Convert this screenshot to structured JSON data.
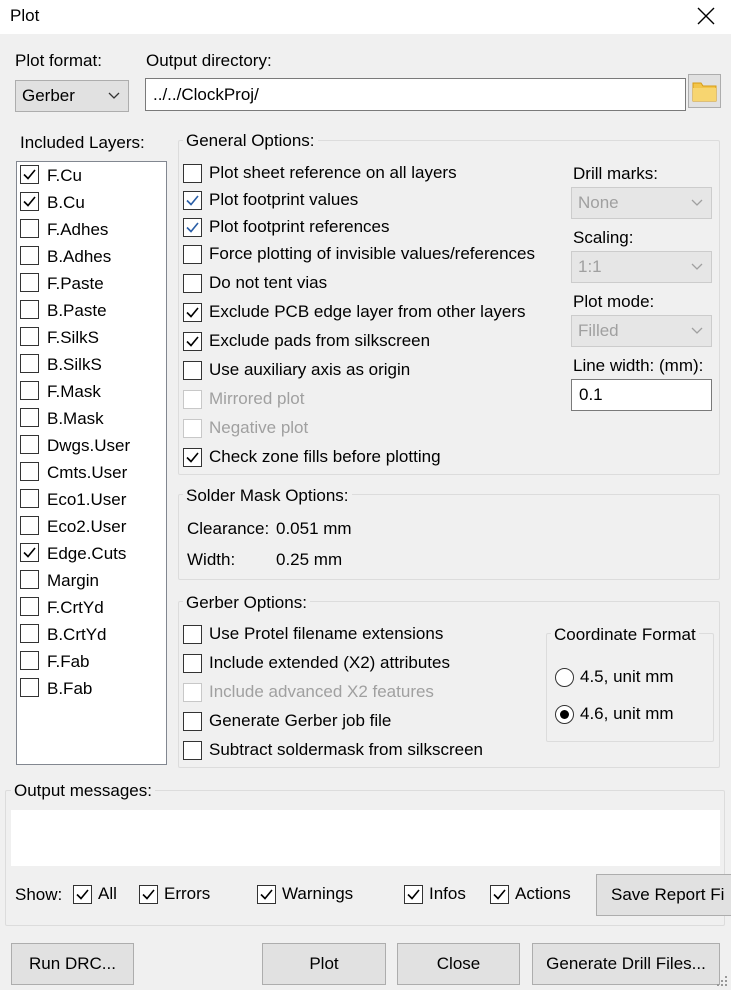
{
  "window": {
    "title": "Plot"
  },
  "plot_format": {
    "label": "Plot format:",
    "value": "Gerber"
  },
  "output_directory": {
    "label": "Output directory:",
    "value": "../../ClockProj/"
  },
  "layers": {
    "title": "Included Layers:",
    "items": [
      {
        "label": "F.Cu",
        "checked": true
      },
      {
        "label": "B.Cu",
        "checked": true
      },
      {
        "label": "F.Adhes",
        "checked": false
      },
      {
        "label": "B.Adhes",
        "checked": false
      },
      {
        "label": "F.Paste",
        "checked": false
      },
      {
        "label": "B.Paste",
        "checked": false
      },
      {
        "label": "F.SilkS",
        "checked": false
      },
      {
        "label": "B.SilkS",
        "checked": false
      },
      {
        "label": "F.Mask",
        "checked": false
      },
      {
        "label": "B.Mask",
        "checked": false
      },
      {
        "label": "Dwgs.User",
        "checked": false
      },
      {
        "label": "Cmts.User",
        "checked": false
      },
      {
        "label": "Eco1.User",
        "checked": false
      },
      {
        "label": "Eco2.User",
        "checked": false
      },
      {
        "label": "Edge.Cuts",
        "checked": true
      },
      {
        "label": "Margin",
        "checked": false
      },
      {
        "label": "F.CrtYd",
        "checked": false
      },
      {
        "label": "B.CrtYd",
        "checked": false
      },
      {
        "label": "F.Fab",
        "checked": false
      },
      {
        "label": "B.Fab",
        "checked": false
      }
    ]
  },
  "general": {
    "title": "General Options:",
    "options": [
      {
        "label": "Plot sheet reference on all layers",
        "checked": false,
        "enabled": true
      },
      {
        "label": "Plot footprint values",
        "checked": true,
        "enabled": true
      },
      {
        "label": "Plot footprint references",
        "checked": true,
        "enabled": true
      },
      {
        "label": "Force plotting of invisible values/references",
        "checked": false,
        "enabled": true
      },
      {
        "label": "Do not tent vias",
        "checked": false,
        "enabled": true
      },
      {
        "label": "Exclude PCB edge layer from other layers",
        "checked": true,
        "enabled": true
      },
      {
        "label": "Exclude pads from silkscreen",
        "checked": true,
        "enabled": true
      },
      {
        "label": "Use auxiliary axis as origin",
        "checked": false,
        "enabled": true
      },
      {
        "label": "Mirrored plot",
        "checked": false,
        "enabled": false
      },
      {
        "label": "Negative plot",
        "checked": false,
        "enabled": false
      },
      {
        "label": "Check zone fills before plotting",
        "checked": true,
        "enabled": true
      }
    ],
    "drill_marks": {
      "label": "Drill marks:",
      "value": "None"
    },
    "scaling": {
      "label": "Scaling:",
      "value": "1:1"
    },
    "plot_mode": {
      "label": "Plot mode:",
      "value": "Filled"
    },
    "line_width": {
      "label": "Line width: (mm):",
      "value": "0.1"
    }
  },
  "solder_mask": {
    "title": "Solder Mask Options:",
    "clearance_label": "Clearance:",
    "clearance_value": "0.051 mm",
    "width_label": "Width:",
    "width_value": "0.25 mm"
  },
  "gerber": {
    "title": "Gerber Options:",
    "options": [
      {
        "label": "Use Protel filename extensions",
        "checked": false,
        "enabled": true
      },
      {
        "label": "Include extended (X2) attributes",
        "checked": false,
        "enabled": true
      },
      {
        "label": "Include advanced X2 features",
        "checked": false,
        "enabled": false
      },
      {
        "label": "Generate Gerber job file",
        "checked": false,
        "enabled": true
      },
      {
        "label": "Subtract soldermask from silkscreen",
        "checked": false,
        "enabled": true
      }
    ],
    "coordinate_format": {
      "title": "Coordinate Format",
      "options": [
        {
          "label": "4.5, unit mm",
          "selected": false
        },
        {
          "label": "4.6, unit mm",
          "selected": true
        }
      ]
    }
  },
  "messages": {
    "title": "Output messages:",
    "show_label": "Show:",
    "filters": [
      {
        "label": "All",
        "checked": true
      },
      {
        "label": "Errors",
        "checked": true
      },
      {
        "label": "Warnings",
        "checked": true
      },
      {
        "label": "Infos",
        "checked": true
      },
      {
        "label": "Actions",
        "checked": true
      }
    ],
    "save_report": "Save Report Fi"
  },
  "buttons": {
    "run_drc": "Run DRC...",
    "plot": "Plot",
    "close": "Close",
    "drill_files": "Generate Drill Files..."
  }
}
